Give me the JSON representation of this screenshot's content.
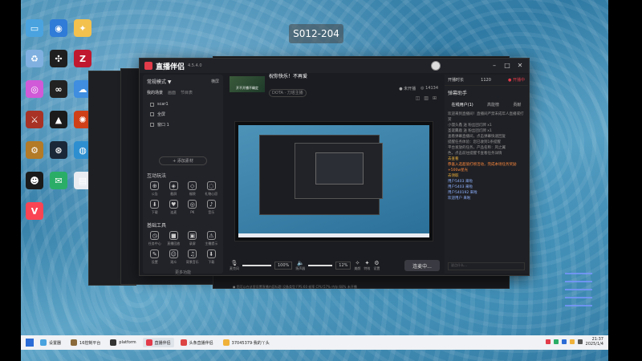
{
  "watermark": "S012-204",
  "desktop": {
    "icons": [
      {
        "name": "this-pc-icon",
        "label": "",
        "color": "#4aa3df",
        "glyph": "▭"
      },
      {
        "name": "browser-icon",
        "label": "",
        "color": "#2f7bd8",
        "glyph": "◉"
      },
      {
        "name": "tool-icon",
        "label": "",
        "color": "#f2c14e",
        "glyph": "✦"
      },
      {
        "name": "recycle-bin-icon",
        "label": "",
        "color": "#7fb0e0",
        "glyph": "♻"
      },
      {
        "name": "razer-icon",
        "label": "",
        "color": "#1f1f1f",
        "glyph": "✣"
      },
      {
        "name": "app-z-icon",
        "label": "",
        "color": "#c0182e",
        "glyph": "Z"
      },
      {
        "name": "color-wheel-icon",
        "label": "",
        "color": "#d05ad8",
        "glyph": "◎"
      },
      {
        "name": "geforce-icon",
        "label": "",
        "color": "#222",
        "glyph": "∞"
      },
      {
        "name": "cloud-icon",
        "label": "",
        "color": "#3f8ee0",
        "glyph": "☁"
      },
      {
        "name": "game-icon-1",
        "label": "",
        "color": "#a83225",
        "glyph": "⚔"
      },
      {
        "name": "triangle-icon",
        "label": "",
        "color": "#1b1b1b",
        "glyph": "▲"
      },
      {
        "name": "game-icon-2",
        "label": "",
        "color": "#d04018",
        "glyph": "✺"
      },
      {
        "name": "game-icon-3",
        "label": "",
        "color": "#b37a27",
        "glyph": "⚙"
      },
      {
        "name": "steam-icon",
        "label": "",
        "color": "#1b2838",
        "glyph": "⊛"
      },
      {
        "name": "globe-icon",
        "label": "",
        "color": "#2e8fd0",
        "glyph": "◍"
      },
      {
        "name": "qq-icon",
        "label": "",
        "color": "#1a1a1a",
        "glyph": "☻"
      },
      {
        "name": "wechat-icon",
        "label": "",
        "color": "#2aae67",
        "glyph": "✉"
      },
      {
        "name": "file-icon",
        "label": "",
        "color": "#e9edf2",
        "glyph": "▤"
      },
      {
        "name": "valorant-icon",
        "label": "",
        "color": "#fa4454",
        "glyph": "V"
      }
    ]
  },
  "main_window": {
    "app_name": "直播伴侣",
    "version": "4.5.4.0",
    "left_panel": {
      "mode": "常规模式 ▼",
      "mode_right": "横屏",
      "mode_right2": "竖屏",
      "tabs": [
        "我的场景",
        "画面",
        "节目表"
      ],
      "scenes": [
        "scar1",
        "全屏",
        "窗口 1"
      ],
      "add_source": "+ 添加素材",
      "interact_title": "互动玩法",
      "interact_tools": [
        {
          "glyph": "⊕",
          "label": "公告"
        },
        {
          "glyph": "◈",
          "label": "截屏"
        },
        {
          "glyph": "◇",
          "label": "福袋"
        },
        {
          "glyph": "◌",
          "label": "礼物心愿"
        },
        {
          "glyph": "⬇",
          "label": "下载"
        },
        {
          "glyph": "♥",
          "label": "连麦"
        },
        {
          "glyph": "◎",
          "label": "PK"
        },
        {
          "glyph": "♪",
          "label": "音乐"
        }
      ],
      "basic_title": "基础工具",
      "basic_tools": [
        {
          "glyph": "◷",
          "label": "任务中心"
        },
        {
          "glyph": "■",
          "label": "直播回放"
        },
        {
          "glyph": "▣",
          "label": "录屏"
        },
        {
          "glyph": "⚠",
          "label": "主播提示"
        },
        {
          "glyph": "✎",
          "label": "设置"
        },
        {
          "glyph": "☺",
          "label": "观众"
        },
        {
          "glyph": "♫",
          "label": "背景音乐"
        },
        {
          "glyph": "⬇",
          "label": "下载"
        }
      ],
      "more": "更多功能"
    },
    "center": {
      "cover_label": "开不开播不确定",
      "stream_title": "祝你快乐！不再爱",
      "category": "DOTA · 刀塔主播",
      "stats": [
        "● 未开播",
        "◎ 14134"
      ],
      "toolbar_icons": [
        "◫",
        "▥",
        "⊞"
      ],
      "controls": {
        "mic_label": "麦克风",
        "mic_pct": "100%",
        "speaker_label": "扬声器",
        "speaker_pct": "12%",
        "beauty": "美颜",
        "effects": "特效",
        "settings": "设置",
        "go_live": "连麦中..."
      },
      "status": "● 您可以在这里设置直播内容标题  设备类型  FPS:60  帧率  CPU:57%  内存:68%  未开播"
    },
    "right_panel": {
      "top_label": "开播时长",
      "live_badge": "● 开播中",
      "count": "1120",
      "sub_title": "弹幕助手",
      "tabs": [
        "在线用户(1)",
        "高能榜",
        "贡献"
      ],
      "messages": [
        "欢迎来到直播间！直播间严禁未成年人直播或打赏",
        "小馒头鑫 送 粉丝团灯牌 x1",
        "圣诞麋鹿 送 粉丝团灯牌 x1",
        "查看弹幕直播间，点击弹幕快速回复",
        "提醒任务体验：您已收到1条提醒",
        "平台发放的任务，产品名称：风之翼",
        "色，点击前往提醒卡查看任务详情",
        "去查看",
        "恭喜入选超值打榜活动，完成本场任务奖励+500w星光",
        "去领取",
        "用户5403 来啦",
        "用户5403 来啦",
        "用户540192 来啦",
        "欢迎用户 来啦"
      ],
      "input_placeholder": "说点什么…"
    }
  },
  "taskbar": {
    "items": [
      {
        "label": "设置器",
        "color": "#4aa3df"
      },
      {
        "label": "16控制平台",
        "color": "#8a6a3a"
      },
      {
        "label": "platform",
        "color": "#333"
      },
      {
        "label": "直播伴侣",
        "color": "#e23b4a"
      },
      {
        "label": "头条直播伴侣",
        "color": "#d44"
      },
      {
        "label": "37045379·我的丫头",
        "color": "#f0b23a"
      }
    ],
    "time": "21:37",
    "date": "2025/1/4"
  }
}
